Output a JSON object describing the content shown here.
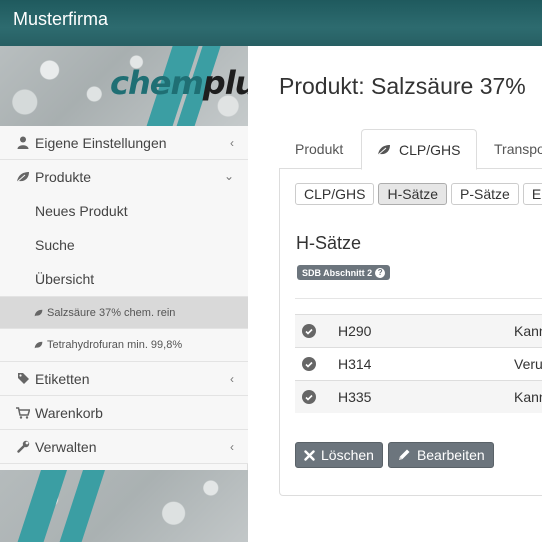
{
  "app": {
    "title": "Musterfirma"
  },
  "logo": {
    "part1": "chem",
    "part2": "plus"
  },
  "sidebar": {
    "items": [
      {
        "label": "Eigene Einstellungen",
        "icon": "user-icon"
      },
      {
        "label": "Produkte",
        "icon": "leaf-icon"
      },
      {
        "label": "Etiketten",
        "icon": "tag-icon"
      },
      {
        "label": "Warenkorb",
        "icon": "cart-icon"
      },
      {
        "label": "Verwalten",
        "icon": "wrench-icon"
      }
    ],
    "products_sub": [
      "Neues Produkt",
      "Suche",
      "Übersicht"
    ],
    "products_open": [
      {
        "label": "Salzsäure 37% chem. rein",
        "active": true
      },
      {
        "label": "Tetrahydrofuran min. 99,8%",
        "active": false
      }
    ]
  },
  "main": {
    "page_title": "Produkt: Salzsäure 37%",
    "tabs": [
      "Produkt",
      "CLP/GHS",
      "Transport"
    ],
    "active_tab": "CLP/GHS",
    "subtabs": [
      "CLP/GHS",
      "H-Sätze",
      "P-Sätze",
      "EU"
    ],
    "active_subtab": "H-Sätze",
    "section_title": "H-Sätze",
    "badge": "SDB Abschnitt 2",
    "rows": [
      {
        "code": "H290",
        "text": "Kann gegenüber Metallen korrosiv sein."
      },
      {
        "code": "H314",
        "text": "Verursacht schwere Verätzungen der Haut."
      },
      {
        "code": "H335",
        "text": "Kann die Atemwege reizen."
      }
    ],
    "actions": {
      "delete": "Löschen",
      "edit": "Bearbeiten"
    }
  },
  "colors": {
    "topbar": "#2d6b6f",
    "accent": "#3b9ea3",
    "button": "#6c757d",
    "active_nav": "#d9d9d9"
  }
}
